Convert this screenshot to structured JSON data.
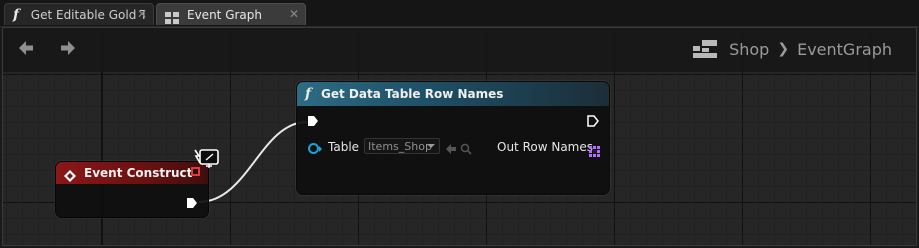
{
  "tabs": [
    {
      "label": "Get Editable Gold T",
      "icon": "function-icon",
      "close": "✕",
      "active": false
    },
    {
      "label": "Event Graph",
      "icon": "event-graph-icon",
      "close": "✕",
      "active": true
    }
  ],
  "toolbar": {
    "back_icon": "arrow-left-icon",
    "forward_icon": "arrow-right-icon"
  },
  "breadcrumb": {
    "blueprint": "Shop",
    "separator": "❯",
    "graph": "EventGraph"
  },
  "event_node": {
    "title": "Event Construct",
    "header_color": "#8a1818"
  },
  "function_node": {
    "title": "Get Data Table Row Names",
    "header_color": "#2d6b84",
    "table_label": "Table",
    "table_value": "Items_Shop",
    "out_label": "Out Row Names"
  },
  "colors": {
    "exec_wire": "#e8e8e8",
    "table_pin": "#1aa5d8",
    "array_pin": "#b66cff"
  }
}
